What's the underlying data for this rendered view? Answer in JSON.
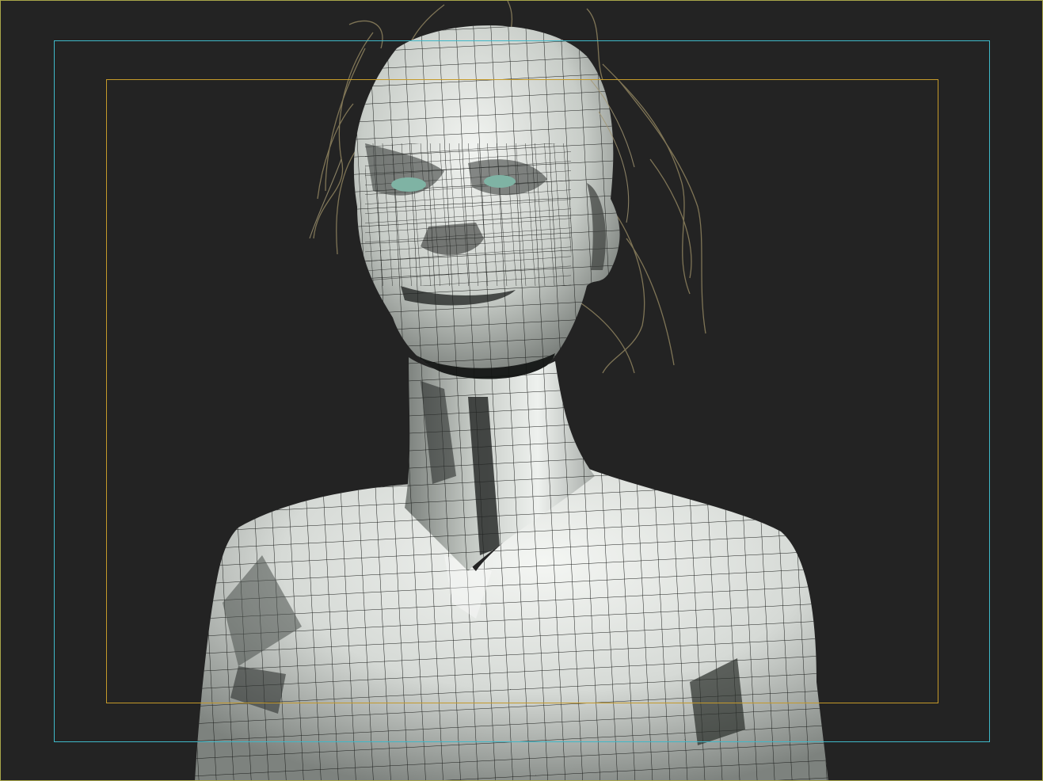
{
  "viewport": {
    "background_color": "#232323",
    "border_color": "#a8a64a",
    "safe_frame_outer_color": "#3fb8c8",
    "safe_frame_inner_color": "#c59a2a"
  },
  "model": {
    "mesh_fill_light": "#e8ece8",
    "mesh_fill_mid": "#bcc2bd",
    "mesh_fill_dark": "#5a5f5b",
    "wire_color": "#1a1c1a",
    "hair_color": "#8a7e5c",
    "eye_color": "#7fb3a4"
  }
}
